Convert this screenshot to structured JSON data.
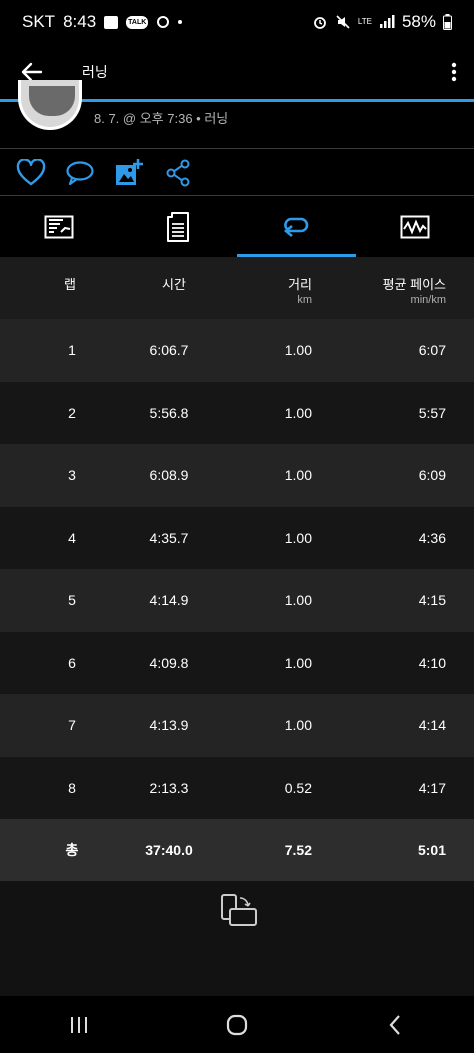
{
  "status": {
    "carrier": "SKT",
    "time": "8:43",
    "talk_badge": "TALK",
    "network": "LTE",
    "battery": "58%"
  },
  "header": {
    "title": "러닝"
  },
  "activity": {
    "meta": "8. 7. @ 오후 7:36 • 러닝"
  },
  "icons": {
    "back": "arrow-left-icon",
    "menu": "more-vertical-icon",
    "like": "heart-icon",
    "comment": "comment-icon",
    "photo": "add-photo-icon",
    "share": "share-icon",
    "rotate": "rotate-screen-icon"
  },
  "tabs": [
    {
      "name": "summary",
      "icon": "chart-icon",
      "active": false
    },
    {
      "name": "details",
      "icon": "document-icon",
      "active": false
    },
    {
      "name": "laps",
      "icon": "laps-icon",
      "active": true
    },
    {
      "name": "graphs",
      "icon": "graph-icon",
      "active": false
    }
  ],
  "colors": {
    "accent": "#2f9ae8",
    "background": "#000000"
  },
  "table": {
    "headers": {
      "lap": "랩",
      "time": "시간",
      "distance": "거리",
      "distance_unit": "km",
      "pace": "평균 페이스",
      "pace_unit": "min/km"
    },
    "rows": [
      {
        "lap": "1",
        "time": "6:06.7",
        "distance": "1.00",
        "pace": "6:07"
      },
      {
        "lap": "2",
        "time": "5:56.8",
        "distance": "1.00",
        "pace": "5:57"
      },
      {
        "lap": "3",
        "time": "6:08.9",
        "distance": "1.00",
        "pace": "6:09"
      },
      {
        "lap": "4",
        "time": "4:35.7",
        "distance": "1.00",
        "pace": "4:36"
      },
      {
        "lap": "5",
        "time": "4:14.9",
        "distance": "1.00",
        "pace": "4:15"
      },
      {
        "lap": "6",
        "time": "4:09.8",
        "distance": "1.00",
        "pace": "4:10"
      },
      {
        "lap": "7",
        "time": "4:13.9",
        "distance": "1.00",
        "pace": "4:14"
      },
      {
        "lap": "8",
        "time": "2:13.3",
        "distance": "0.52",
        "pace": "4:17"
      }
    ],
    "total": {
      "lap": "총",
      "time": "37:40.0",
      "distance": "7.52",
      "pace": "5:01"
    }
  }
}
